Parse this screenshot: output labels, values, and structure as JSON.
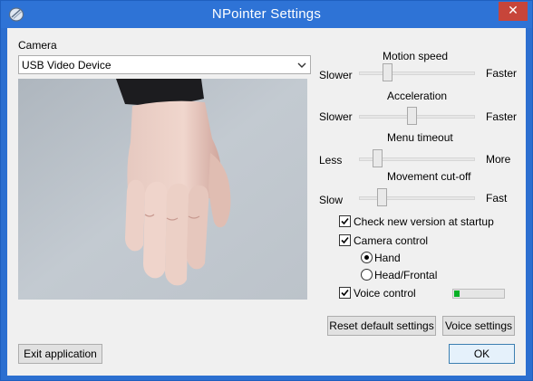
{
  "window": {
    "title": "NPointer Settings",
    "close_glyph": "✕"
  },
  "camera": {
    "label": "Camera",
    "device_selected": "USB Video Device"
  },
  "sliders": [
    {
      "title": "Motion speed",
      "min_label": "Slower",
      "max_label": "Faster",
      "value": 0.22
    },
    {
      "title": "Acceleration",
      "min_label": "Slower",
      "max_label": "Faster",
      "value": 0.45
    },
    {
      "title": "Menu timeout",
      "min_label": "Less",
      "max_label": "More",
      "value": 0.13
    },
    {
      "title": "Movement cut-off",
      "min_label": "Slow",
      "max_label": "Fast",
      "value": 0.17
    }
  ],
  "options": {
    "check_version": {
      "label": "Check new version at startup",
      "checked": true
    },
    "camera_control": {
      "label": "Camera control",
      "checked": true
    },
    "mode_hand": {
      "label": "Hand",
      "selected": true
    },
    "mode_head": {
      "label": "Head/Frontal",
      "selected": false
    },
    "voice_control": {
      "label": "Voice control",
      "checked": true,
      "level": 0.12
    }
  },
  "buttons": {
    "reset": "Reset default settings",
    "voice_settings": "Voice settings",
    "exit": "Exit application",
    "ok": "OK"
  },
  "colors": {
    "titlebar": "#2e73d6",
    "close": "#c7453a",
    "level": "#06b025"
  }
}
